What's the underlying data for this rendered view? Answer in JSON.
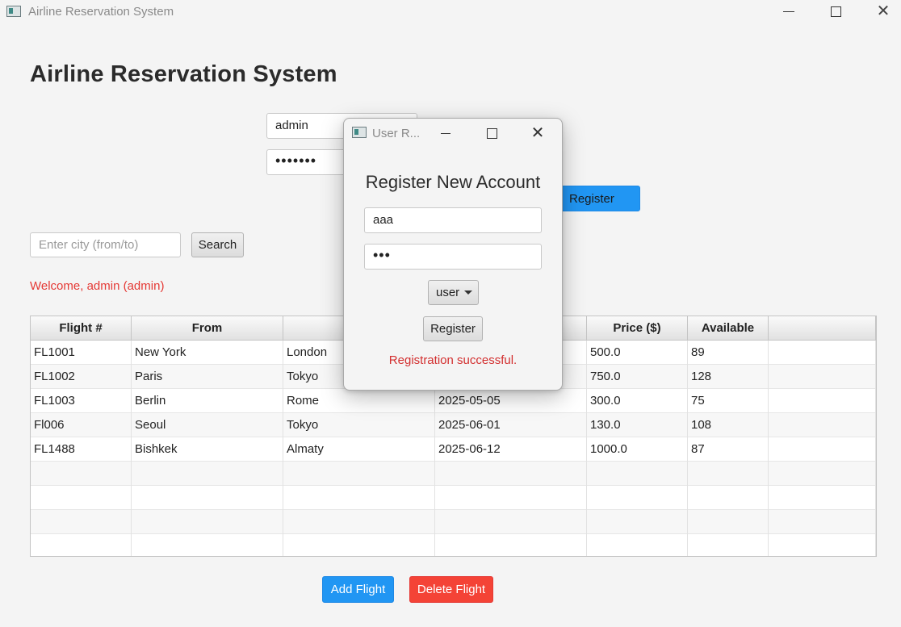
{
  "window": {
    "title": "Airline Reservation System"
  },
  "main": {
    "heading": "Airline Reservation System",
    "login": {
      "username_value": "admin",
      "password_mask": "•••••••"
    },
    "register_label": "Register",
    "search": {
      "placeholder": "Enter city (from/to)",
      "button_label": "Search"
    },
    "welcome_text": "Welcome, admin (admin)",
    "table": {
      "headers": [
        "Flight #",
        "From",
        "",
        "",
        "Price ($)",
        "Available",
        ""
      ],
      "rows": [
        [
          "FL1001",
          "New York",
          "London",
          "",
          "500.0",
          "89"
        ],
        [
          "FL1002",
          "Paris",
          "Tokyo",
          "",
          "750.0",
          "128"
        ],
        [
          "FL1003",
          "Berlin",
          "Rome",
          "2025-05-05",
          "300.0",
          "75"
        ],
        [
          "Fl006",
          "Seoul",
          "Tokyo",
          "2025-06-01",
          "130.0",
          "108"
        ],
        [
          "FL1488",
          "Bishkek",
          "Almaty",
          "2025-06-12",
          "1000.0",
          "87"
        ]
      ]
    },
    "add_flight_label": "Add Flight",
    "delete_flight_label": "Delete Flight"
  },
  "dialog": {
    "title": "User R...",
    "heading": "Register New Account",
    "username_value": "aaa",
    "password_mask": "•••",
    "role_value": "user",
    "register_label": "Register",
    "status_text": "Registration successful."
  },
  "colors": {
    "accent_blue": "#2196f3",
    "danger_red": "#f44336",
    "status_red": "#d32f2f"
  },
  "icons": [
    "app-icon",
    "minimize-icon",
    "maximize-icon",
    "close-icon",
    "dropdown-caret-icon"
  ]
}
